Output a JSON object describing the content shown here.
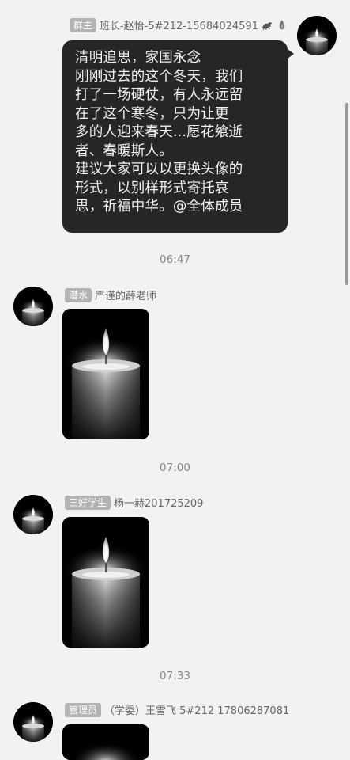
{
  "messages": [
    {
      "badge": "群主",
      "sender": "班长-赵怡-5#212-15684024591",
      "text_lines": [
        "清明追思，家国永念",
        "刚刚过去的这个冬天，我们",
        "打了一场硬仗，有人永远留",
        "在了这个寒冬，只为让更",
        "多的人迎来春天...愿花飨逝",
        "者、春暖斯人。",
        "建议大家可以以更换头像的",
        "形式，以别样形式寄托哀",
        "思，祈福中华。@全体成员"
      ]
    },
    {
      "time": "06:47",
      "badge": "潜水",
      "sender": "严谨的薛老师"
    },
    {
      "time": "07:00",
      "badge": "三好学生",
      "sender": "杨一赫201725209"
    },
    {
      "time": "07:33",
      "badge": "管理员",
      "sender": "（学委）王雪飞 5#212 17806287081"
    }
  ],
  "icons": [
    "dragon-icon",
    "flame-icon",
    "candle-icon"
  ],
  "colors": {
    "background": "#f2f2f2",
    "bubble": "#262626",
    "badge": "#b3b3b3"
  }
}
